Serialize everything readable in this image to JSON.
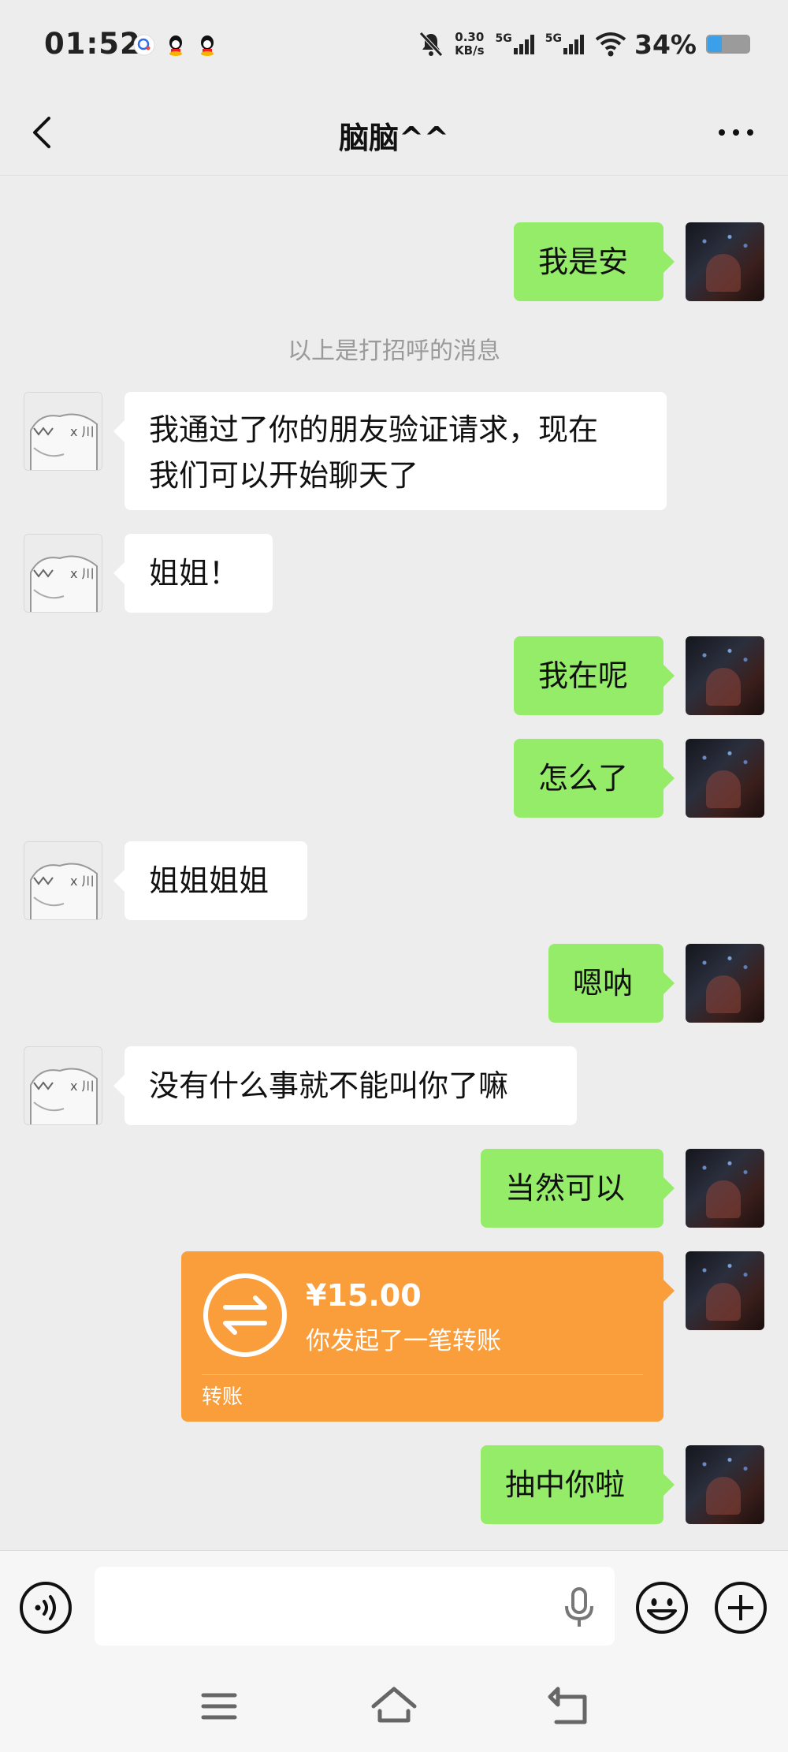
{
  "status_bar": {
    "time": "01:52",
    "net_speed_value": "0.30",
    "net_speed_unit": "KB/s",
    "sim1_label": "5G",
    "sim2_label": "5G",
    "battery_percent": "34%",
    "battery_level": 0.34,
    "notification_icons": [
      "search-app-icon",
      "qq-icon",
      "qq-icon"
    ]
  },
  "header": {
    "title": "脑脑^^"
  },
  "messages": [
    {
      "from": "self",
      "text": "我是安"
    },
    {
      "type": "note",
      "text": "以上是打招呼的消息"
    },
    {
      "from": "other",
      "text_line1": "我通过了你的朋友验证请求，现在",
      "text_line2": "我们可以开始聊天了"
    },
    {
      "from": "other",
      "text": "姐姐！"
    },
    {
      "from": "self",
      "text": "我在呢"
    },
    {
      "from": "self",
      "text": "怎么了"
    },
    {
      "from": "other",
      "text": "姐姐姐姐"
    },
    {
      "from": "self",
      "text": "嗯呐"
    },
    {
      "from": "other",
      "text": "没有什么事就不能叫你了嘛"
    },
    {
      "from": "self",
      "text": "当然可以"
    },
    {
      "from": "self",
      "type": "transfer",
      "amount": "¥15.00",
      "description": "你发起了一笔转账",
      "label": "转账"
    },
    {
      "from": "self",
      "text": "抽中你啦"
    }
  ],
  "input_bar": {
    "placeholder": "",
    "icons": [
      "voice-icon",
      "mic-icon",
      "emoji-icon",
      "plus-icon"
    ]
  },
  "nav_bar": {
    "icons": [
      "menu-icon",
      "home-icon",
      "back-icon"
    ]
  },
  "colors": {
    "background": "#ededed",
    "self_bubble": "#95ec69",
    "other_bubble": "#ffffff",
    "transfer": "#fa9d3b"
  }
}
